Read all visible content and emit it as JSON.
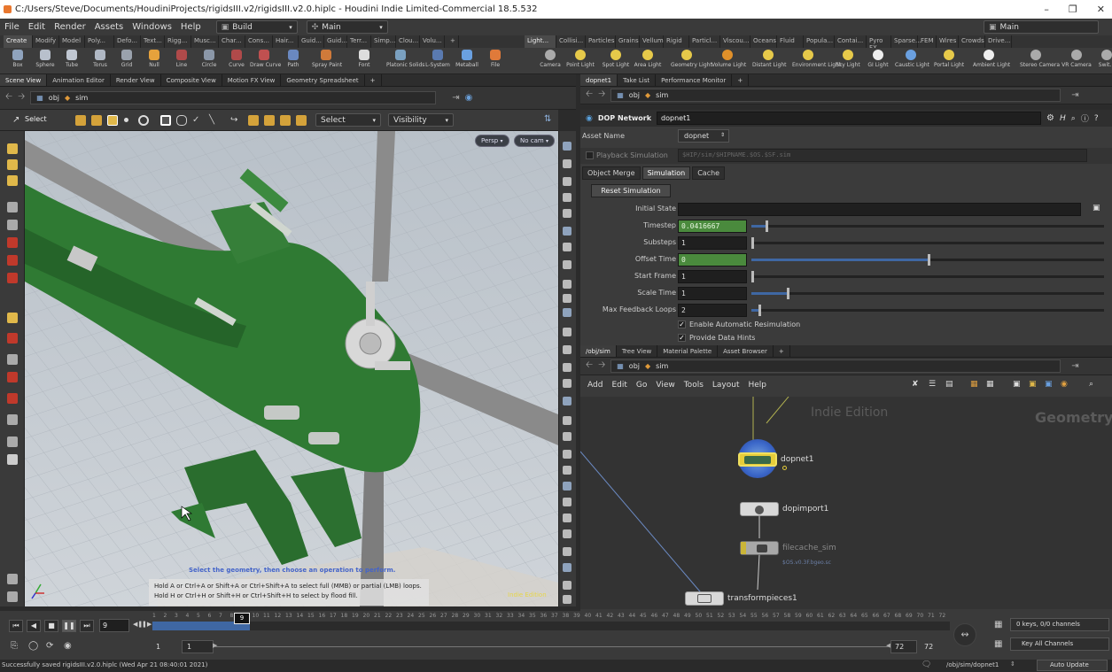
{
  "window": {
    "title": "C:/Users/Steve/Documents/HoudiniProjects/rigidsIII.v2/rigidsIII.v2.0.hiplc - Houdini Indie Limited-Commercial 18.5.532"
  },
  "menu": {
    "items": [
      "File",
      "Edit",
      "Render",
      "Assets",
      "Windows",
      "Help"
    ],
    "desktop": "Build",
    "desktop2": "Main",
    "right_desktop": "Main"
  },
  "shelf": {
    "left_tabs": [
      "Create",
      "Modify",
      "Model",
      "Poly...",
      "Defo...",
      "Text...",
      "Rigg...",
      "Musc...",
      "Char...",
      "Cons...",
      "Hair...",
      "Guid...",
      "Guid...",
      "Terr...",
      "Simp...",
      "Clou...",
      "Volu..."
    ],
    "right_tabs": [
      "Light...",
      "Collisi...",
      "Particles",
      "Grains",
      "Vellum",
      "Rigid ...",
      "Particl...",
      "Viscou...",
      "Oceans",
      "Fluid ...",
      "Popula...",
      "Contai...",
      "Pyro FX",
      "Sparse...",
      "FEM",
      "Wires",
      "Crowds",
      "Drive..."
    ],
    "left_tools": [
      "Box",
      "Sphere",
      "Tube",
      "Torus",
      "Grid",
      "Null",
      "Line",
      "Circle",
      "Curve",
      "Draw Curve",
      "Path",
      "Spray Paint",
      "Font",
      "Platonic Solids",
      "L-System",
      "Metaball",
      "File"
    ],
    "right_tools": [
      "Camera",
      "Point Light",
      "Spot Light",
      "Area Light",
      "Geometry Light",
      "Volume Light",
      "Distant Light",
      "Environment Light",
      "Sky Light",
      "GI Light",
      "Caustic Light",
      "Portal Light",
      "Ambient Light",
      "Stereo Camera",
      "VR Camera",
      "Swit..."
    ]
  },
  "left_pane": {
    "tabs": [
      "Scene View",
      "Animation Editor",
      "Render View",
      "Composite View",
      "Motion FX View",
      "Geometry Spreadsheet"
    ],
    "path": [
      "obj",
      "sim"
    ],
    "select_label": "Select",
    "select_dropdown": "Select",
    "visibility_dropdown": "Visibility",
    "persp_btn": "Persp",
    "cam_btn": "No cam",
    "hint_main": "Select the geometry, then choose an operation to perform.",
    "hint_1": "Hold A or Ctrl+A or Shift+A or Ctrl+Shift+A to select full (MMB) or partial (LMB) loops.",
    "hint_2": "Hold H or Ctrl+H or Shift+H or Ctrl+Shift+H to select by flood fill.",
    "watermark": "Indie Edition"
  },
  "parm_pane": {
    "tabs": [
      "dopnet1",
      "Take List",
      "Performance Monitor"
    ],
    "path": [
      "obj",
      "sim"
    ],
    "network_type": "DOP Network",
    "node_name": "dopnet1",
    "asset_name_label": "Asset Name",
    "asset_name_value": "dopnet",
    "playback_label": "Playback Simulation",
    "playback_path": "$HIP/sim/$HIPNAME.$OS.$SF.sim",
    "subtabs": [
      "Object Merge",
      "Simulation",
      "Cache"
    ],
    "reset_button": "Reset Simulation",
    "params": [
      {
        "label": "Initial State",
        "value": ""
      },
      {
        "label": "Timestep",
        "value": "0.0416667",
        "slider": 0.04
      },
      {
        "label": "Substeps",
        "value": "1",
        "slider": 0.0
      },
      {
        "label": "Offset Time",
        "value": "0",
        "slider": 0.5
      },
      {
        "label": "Start Frame",
        "value": "1",
        "slider": 0.0
      },
      {
        "label": "Scale Time",
        "value": "1",
        "slider": 0.1
      },
      {
        "label": "Max Feedback Loops",
        "value": "2",
        "slider": 0.02
      }
    ],
    "check_1": "Enable Automatic Resimulation",
    "check_2": "Provide Data Hints"
  },
  "net_pane": {
    "tabs": [
      "/obj/sim",
      "Tree View",
      "Material Palette",
      "Asset Browser"
    ],
    "path": [
      "obj",
      "sim"
    ],
    "menu": [
      "Add",
      "Edit",
      "Go",
      "View",
      "Tools",
      "Layout",
      "Help"
    ],
    "watermark": "Indie Edition",
    "context_label": "Geometry",
    "nodes": [
      {
        "name": "dopnet1",
        "sub": ""
      },
      {
        "name": "dopimport1",
        "sub": ""
      },
      {
        "name": "filecache_sim",
        "sub": "$OS.v0.3F.bgeo.sc"
      },
      {
        "name": "transformpieces1",
        "sub": ""
      }
    ]
  },
  "timeline": {
    "current_frame": "9",
    "ticks": [
      "1",
      "2",
      "3",
      "4",
      "5",
      "6",
      "7",
      "8",
      "9",
      "10",
      "11",
      "12",
      "13",
      "14",
      "15",
      "16",
      "17",
      "18",
      "19",
      "20",
      "21",
      "22",
      "23",
      "24",
      "25",
      "26",
      "27",
      "28",
      "29",
      "30",
      "31",
      "32",
      "33",
      "34",
      "35",
      "36",
      "37",
      "38",
      "39",
      "40",
      "41",
      "42",
      "43",
      "44",
      "45",
      "46",
      "47",
      "48",
      "49",
      "50",
      "51",
      "52",
      "53",
      "54",
      "55",
      "56",
      "57",
      "58",
      "59",
      "60",
      "61",
      "62",
      "63",
      "64",
      "65",
      "66",
      "67",
      "68",
      "69",
      "70",
      "71",
      "72"
    ],
    "start": "1",
    "start2": "1",
    "end": "72",
    "end2": "72",
    "keys_label": "0 keys, 0/0 channels",
    "key_all": "Key All Channels"
  },
  "status": {
    "message": "Successfully saved rigidsIII.v2.0.hiplc (Wed Apr 21 08:40:01 2021)",
    "path": "/obj/sim/dopnet1",
    "update_mode": "Auto Update"
  },
  "colors": {
    "accent_blue": "#3f67a3",
    "field_green": "#4a8a3d",
    "heli_green": "#2f7a33"
  }
}
